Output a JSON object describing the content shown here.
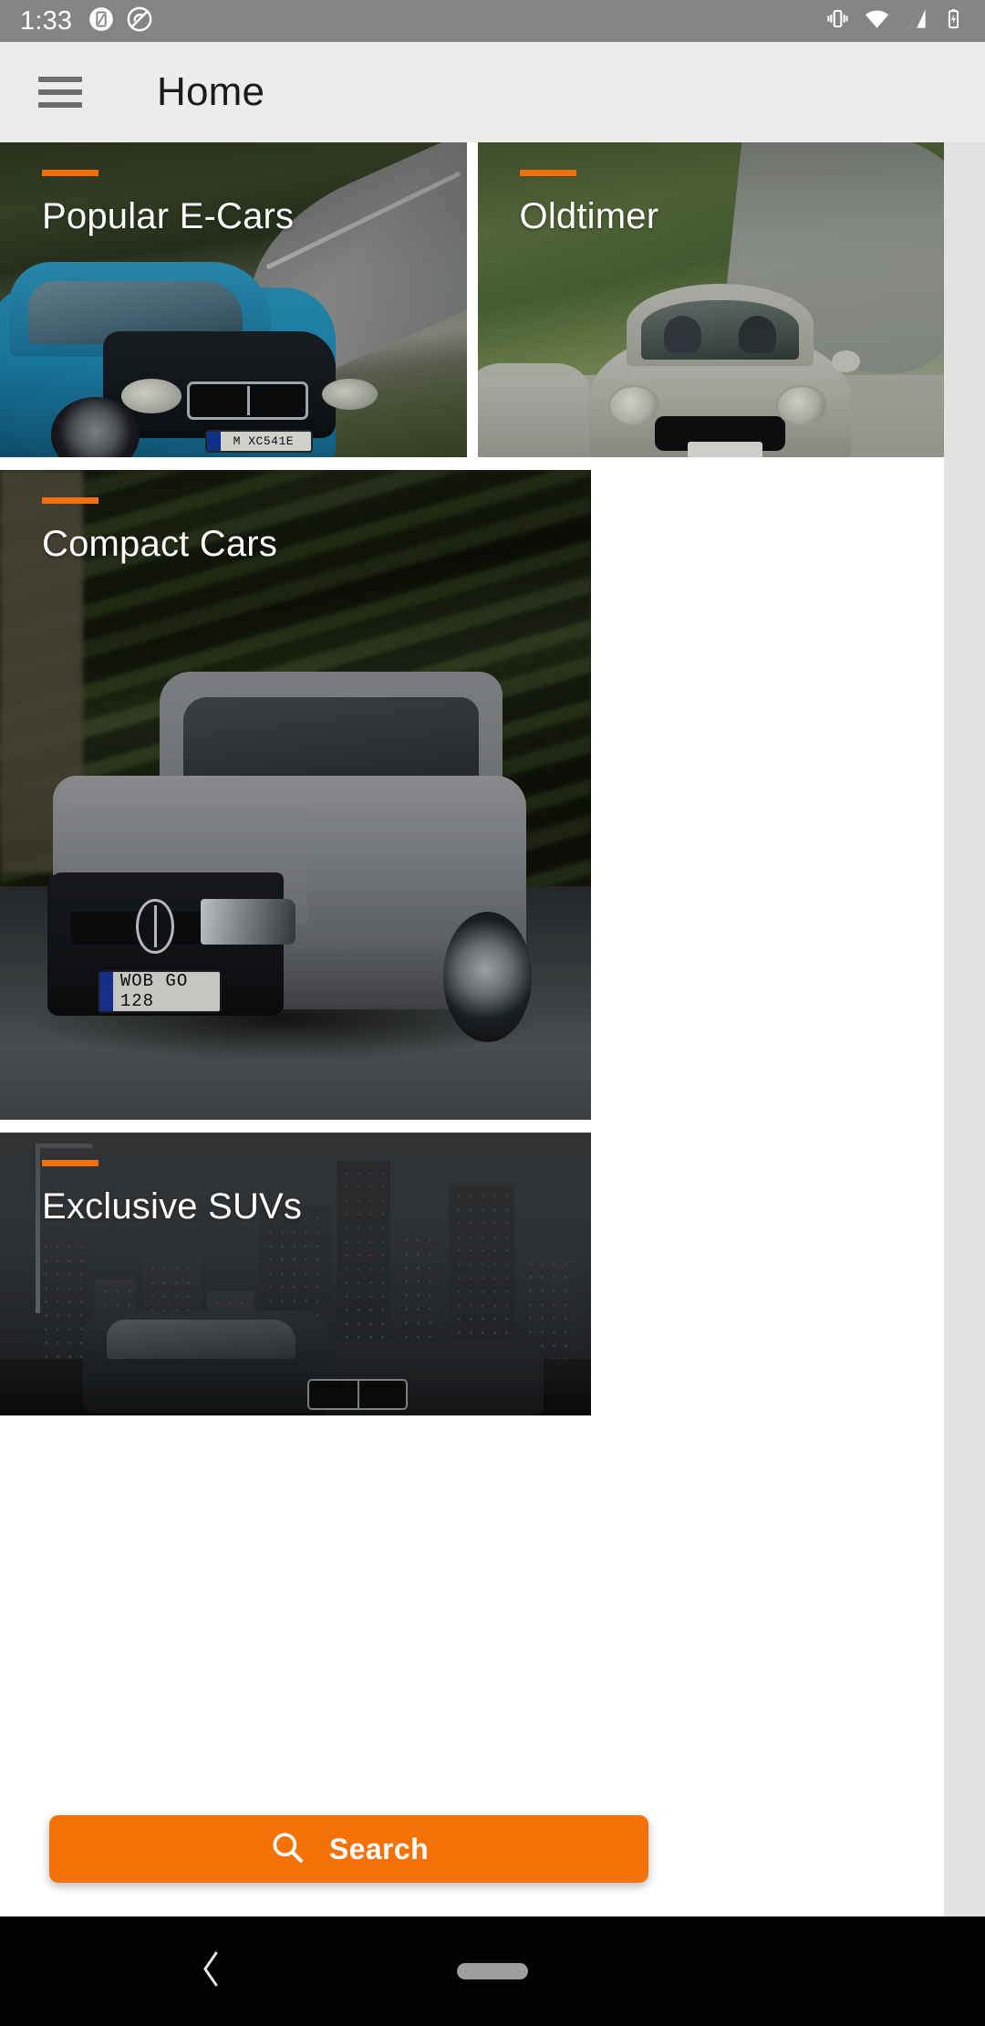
{
  "statusbar": {
    "time": "1:33",
    "left_icons": [
      "screenshot-icon",
      "do-not-disturb-icon"
    ],
    "right_icons": [
      "vibrate-icon",
      "wifi-icon",
      "cellular-signal-icon",
      "battery-charging-icon"
    ],
    "background": "#848484"
  },
  "appbar": {
    "menu_icon": "hamburger-menu-icon",
    "title": "Home",
    "background": "#ECECEC"
  },
  "theme": {
    "accent": "#F2700C",
    "button": "#F57208",
    "surface": "#FFFFFF",
    "scrim": "#E2E2E2"
  },
  "cards": [
    {
      "title": "Popular E-Cars",
      "layout": "half",
      "image": "blue-electric-hatchback-on-mountain-road",
      "plate": "M XC541E"
    },
    {
      "title": "Oldtimer",
      "layout": "half",
      "image": "vintage-silver-coupe-on-grass-track",
      "plate": ""
    },
    {
      "title": "Compact Cars",
      "layout": "full",
      "image": "grey-compact-estate-car-in-motion",
      "plate": "WOB GO 128"
    },
    {
      "title": "Exclusive SUVs",
      "layout": "full",
      "image": "suv-against-city-skyline",
      "plate": ""
    }
  ],
  "search": {
    "icon": "search-icon",
    "label": "Search"
  },
  "navbar": {
    "back_icon": "back-chevron-icon",
    "home_icon": "home-pill-icon",
    "background": "#000000"
  }
}
